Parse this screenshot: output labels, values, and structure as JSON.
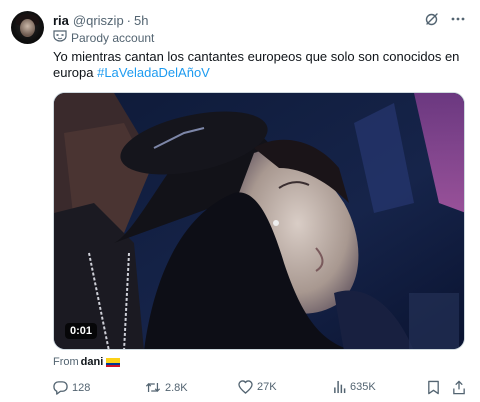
{
  "post": {
    "display_name": "ria",
    "handle": "@qriszip",
    "separator": "·",
    "time": "5h",
    "parody_label": "Parody account",
    "text_before_hashtag": "Yo mientras cantan los cantantes europeos que solo son conocidos en europa ",
    "hashtag": "#LaVeladaDelAñoV",
    "video_duration": "0:01",
    "from_label": "From",
    "from_user": "dani",
    "from_flag": "colombia-flag-emoji",
    "metrics": {
      "replies": "128",
      "reposts": "2.8K",
      "likes": "27K",
      "views": "635K"
    },
    "icons": {
      "grok": "grok-icon",
      "more": "more-icon",
      "parody": "parody-mask-icon",
      "reply": "reply-icon",
      "repost": "repost-icon",
      "like": "heart-icon",
      "views": "views-icon",
      "bookmark": "bookmark-icon",
      "share": "share-icon"
    },
    "colors": {
      "text": "#0f1419",
      "secondary": "#536471",
      "accent": "#1d9bf0"
    }
  }
}
